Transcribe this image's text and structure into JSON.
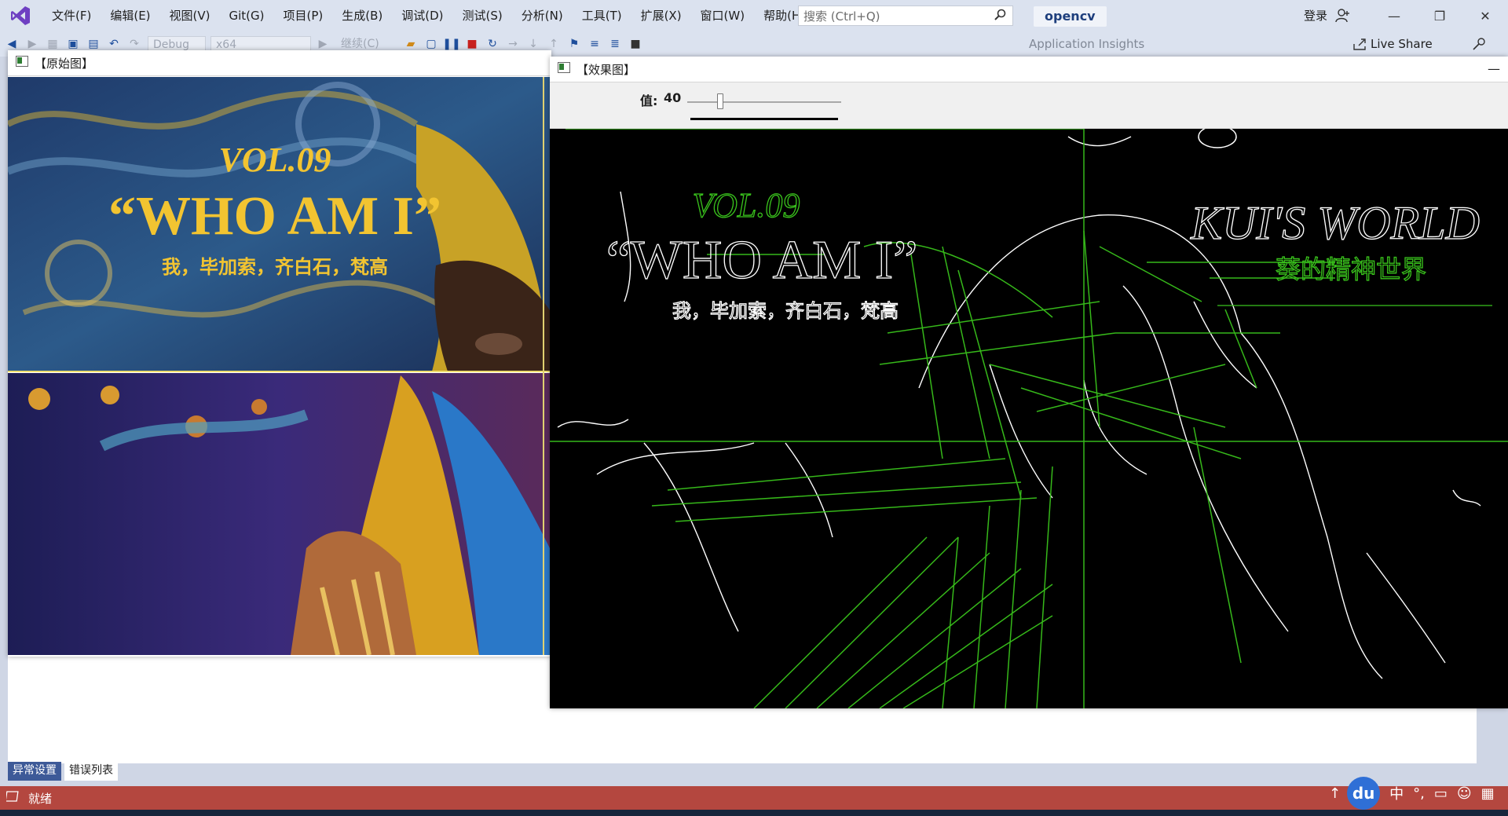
{
  "menu": {
    "items": [
      "文件(F)",
      "编辑(E)",
      "视图(V)",
      "Git(G)",
      "项目(P)",
      "生成(B)",
      "调试(D)",
      "测试(S)",
      "分析(N)",
      "工具(T)",
      "扩展(X)",
      "窗口(W)",
      "帮助(H)"
    ]
  },
  "search": {
    "placeholder": "搜索 (Ctrl+Q)"
  },
  "solution_name": "opencv",
  "account": {
    "login_label": "登录"
  },
  "toolbar": {
    "config": "Debug",
    "platform": "x64",
    "continue_label": "继续(C)",
    "insights_label": "Application Insights",
    "live_share_label": "Live Share"
  },
  "original_window": {
    "title": "【原始图】",
    "poster": {
      "vol": "VOL.09",
      "headline": "“WHO AM I”",
      "subtitle": "我，毕加索，齐白石，梵高"
    }
  },
  "effect_window": {
    "title": "【效果图】",
    "trackbar_label": "值:",
    "trackbar_value": "40",
    "trackbar_fraction": 0.2,
    "overlay_texts": {
      "vol": "VOL.09",
      "headline": "“WHO AM I”",
      "subtitle": "我，毕加索，齐白石，梵高",
      "right_title": "KUI'S WORLD",
      "right_subtitle": "葵的精神世界"
    }
  },
  "bottom_tabs": [
    "异常设置",
    "错误列表"
  ],
  "status": {
    "text": "就绪"
  },
  "tray": {
    "du": "du",
    "ime": "中",
    "punct": "°,"
  },
  "colors": {
    "statusbar": "#b4473f",
    "accent": "#2f6fd6",
    "edge_green": "#39c21c"
  }
}
